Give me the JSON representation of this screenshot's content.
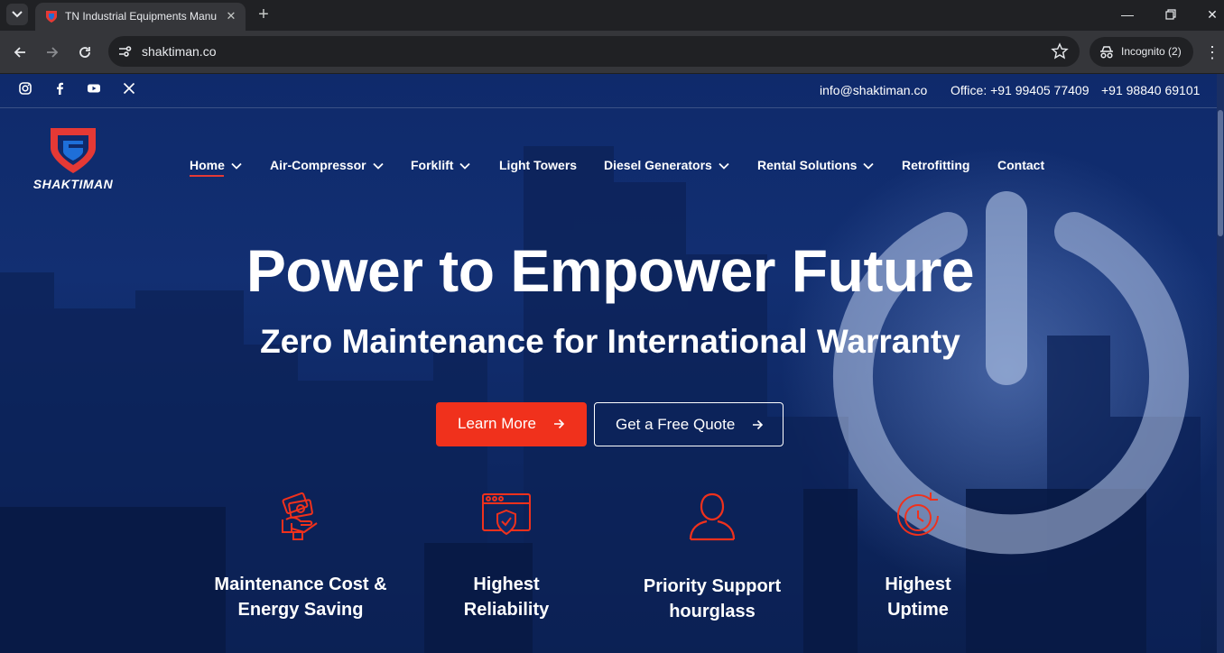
{
  "browser": {
    "tab_title": "TN Industrial Equipments Manu",
    "url": "shaktiman.co",
    "incognito_label": "Incognito (2)",
    "icons": [
      "tab-search-icon",
      "shield-favicon",
      "close-icon",
      "plus-icon",
      "minimize-icon",
      "restore-icon",
      "close-window-icon",
      "back-icon",
      "forward-icon",
      "reload-icon",
      "site-info-icon",
      "star-icon",
      "incognito-icon",
      "menu-dots-icon"
    ]
  },
  "topbar": {
    "socials": [
      "instagram-icon",
      "facebook-icon",
      "youtube-icon",
      "x-icon"
    ],
    "email": "info@shaktiman.co",
    "office": "Office: +91 99405 77409",
    "phone2": "+91 98840 69101"
  },
  "brand": {
    "logo_text": "SHAKTIMAN",
    "colors": {
      "red": "#e53935",
      "blue": "#1e6fd9",
      "cta": "#f0311c"
    }
  },
  "nav": {
    "items": [
      {
        "label": "Home",
        "has_dropdown": true,
        "active": true
      },
      {
        "label": "Air-Compressor",
        "has_dropdown": true
      },
      {
        "label": "Forklift",
        "has_dropdown": true
      },
      {
        "label": "Light Towers",
        "has_dropdown": false
      },
      {
        "label": "Diesel Generators",
        "has_dropdown": true
      },
      {
        "label": "Rental Solutions",
        "has_dropdown": true
      },
      {
        "label": "Retrofitting",
        "has_dropdown": false
      },
      {
        "label": "Contact",
        "has_dropdown": false
      }
    ]
  },
  "hero": {
    "title": "Power to Empower Future",
    "subtitle": "Zero Maintenance for International Warranty",
    "primary_button": "Learn More",
    "secondary_button": "Get a Free Quote"
  },
  "features": [
    {
      "line1": "Maintenance Cost &",
      "line2": "Energy Saving",
      "icon": "money-hand-icon"
    },
    {
      "line1": "Highest",
      "line2": "Reliability",
      "icon": "browser-shield-icon"
    },
    {
      "line1": "Priority Support",
      "line2": "hourglass",
      "icon": "user-support-icon"
    },
    {
      "line1": "Highest",
      "line2": "Uptime",
      "icon": "uptime-clock-icon"
    }
  ]
}
